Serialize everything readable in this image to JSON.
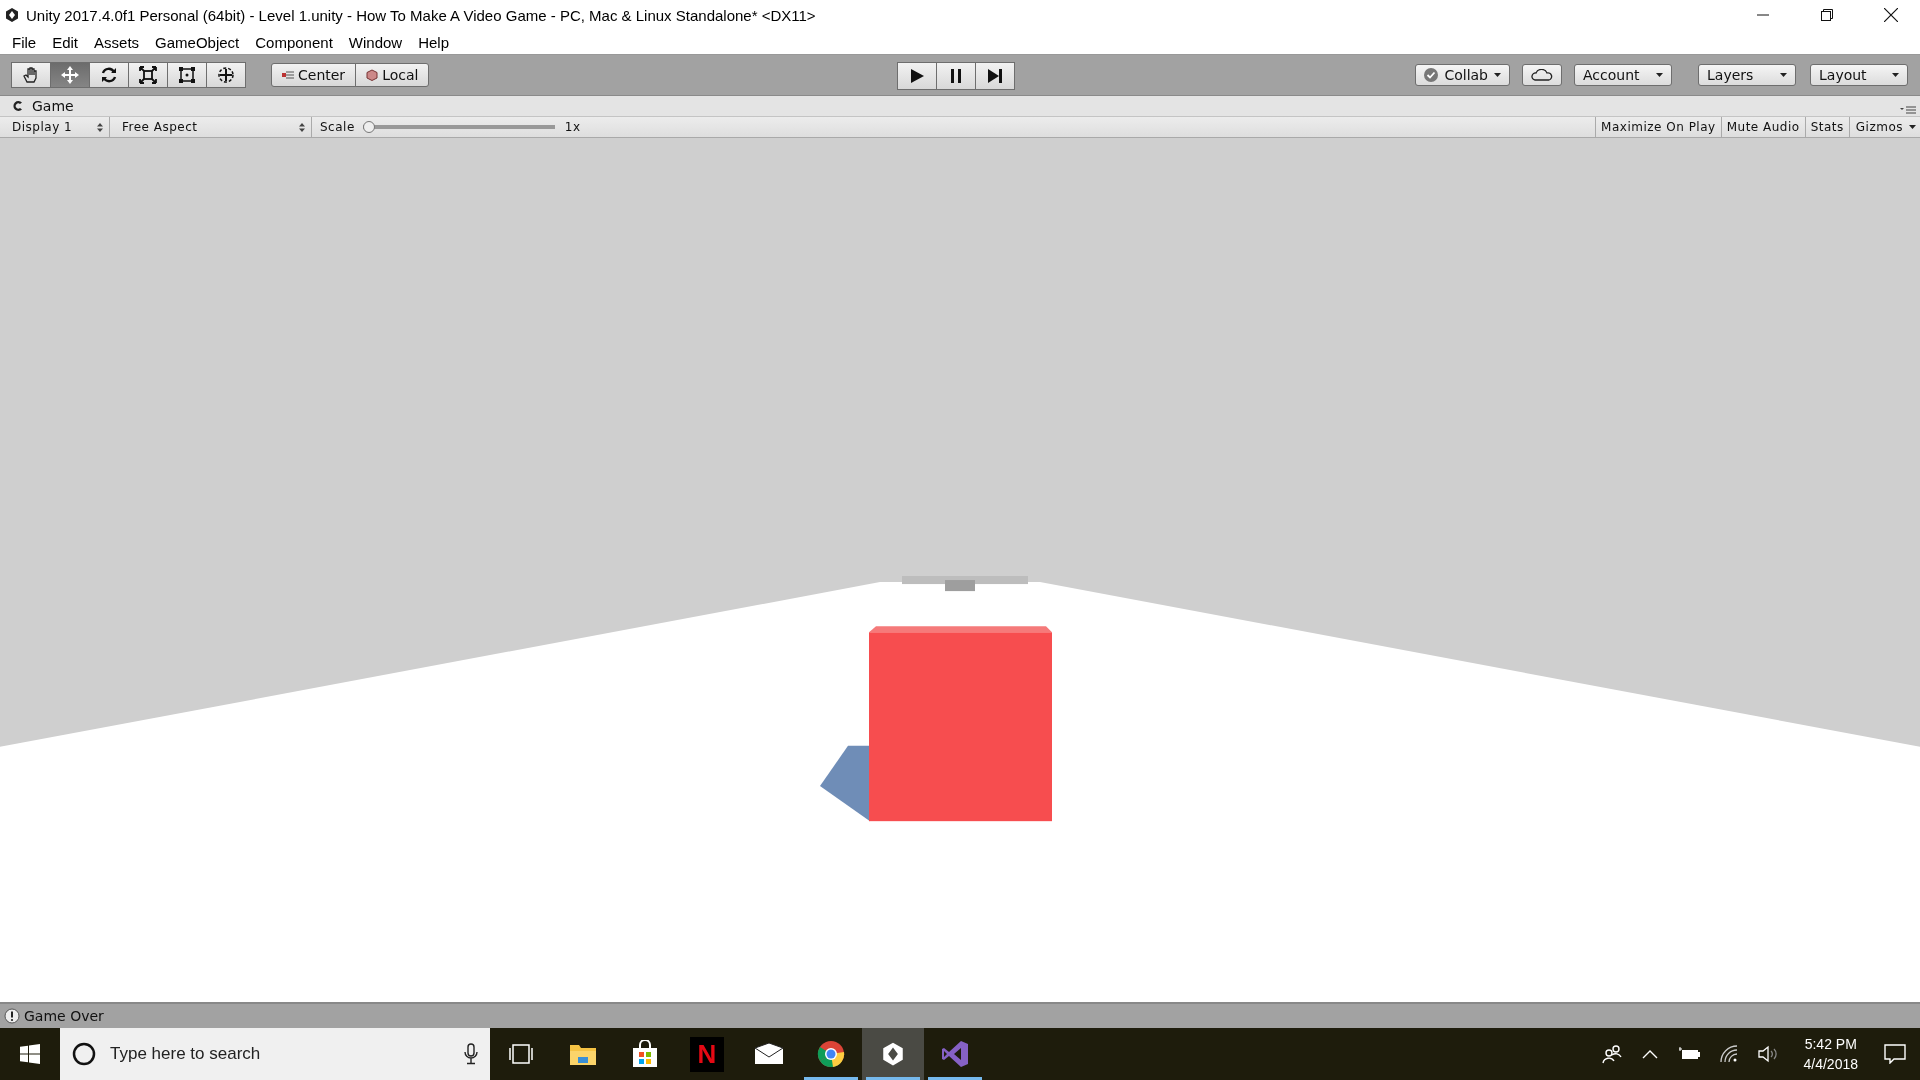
{
  "window": {
    "title": "Unity 2017.4.0f1 Personal (64bit) - Level 1.unity - How To Make A Video Game - PC, Mac & Linux Standalone* <DX11>"
  },
  "menu": [
    "File",
    "Edit",
    "Assets",
    "GameObject",
    "Component",
    "Window",
    "Help"
  ],
  "tools": [
    {
      "kind": "hand",
      "selected": false
    },
    {
      "kind": "move",
      "selected": true
    },
    {
      "kind": "rotate",
      "selected": false
    },
    {
      "kind": "scale",
      "selected": false
    },
    {
      "kind": "rect",
      "selected": false
    },
    {
      "kind": "transform",
      "selected": false
    }
  ],
  "pivot": [
    {
      "kind": "center",
      "label": "Center"
    },
    {
      "kind": "local",
      "label": "Local"
    }
  ],
  "playback": [
    {
      "kind": "play",
      "on": false
    },
    {
      "kind": "pause",
      "on": false
    },
    {
      "kind": "step",
      "on": false
    }
  ],
  "right_buttons": [
    {
      "kind": "collab",
      "label": "Collab"
    },
    {
      "kind": "cloud"
    },
    {
      "kind": "dropdown",
      "label": "Account"
    },
    {
      "kind": "dropdown",
      "label": "Layers"
    },
    {
      "kind": "dropdown",
      "label": "Layout"
    }
  ],
  "game_panel": {
    "tab": "Game",
    "display": "Display 1",
    "aspect": "Free Aspect",
    "scale_label": "Scale",
    "scale": {
      "level": 0
    },
    "scale_reading": "1x",
    "toggles": [
      {
        "label": "Maximize On Play",
        "on": false
      },
      {
        "label": "Mute Audio",
        "on": false
      },
      {
        "label": "Stats",
        "on": false
      }
    ],
    "gizmos": "Gizmos"
  },
  "status": {
    "message": "Game Over"
  },
  "taskbar": {
    "search_placeholder": "Type here to search",
    "apps": [
      {
        "kind": "task-view",
        "running": false,
        "active": false
      },
      {
        "kind": "folder",
        "running": false,
        "active": false
      },
      {
        "kind": "store",
        "running": false,
        "active": false
      },
      {
        "kind": "letter",
        "label": "N",
        "running": false,
        "active": false
      },
      {
        "kind": "mail",
        "running": false,
        "active": false
      },
      {
        "kind": "browser",
        "running": true,
        "active": false
      },
      {
        "kind": "unity",
        "running": true,
        "active": true
      },
      {
        "kind": "studio",
        "running": true,
        "active": false
      }
    ],
    "clock": {
      "time": "5:42 PM",
      "date": "4/4/2018"
    }
  }
}
